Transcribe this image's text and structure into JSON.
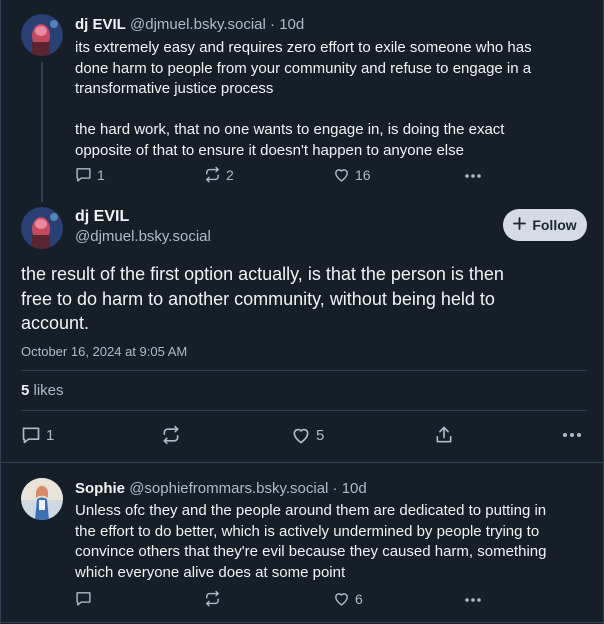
{
  "reply_parent": {
    "author_name": "dj EVIL",
    "author_handle": "@djmuel.bsky.social",
    "time_sep": "·",
    "age": "10d",
    "text_lines": [
      "its extremely easy and requires zero effort to exile someone who has",
      "done harm to people from your community and refuse to engage in a",
      "transformative justice process",
      "",
      "the hard work, that no one wants to engage in, is doing the exact",
      "opposite of that to ensure it doesn't happen to anyone else"
    ],
    "reply_count": "1",
    "repost_count": "2",
    "like_count": "16"
  },
  "main_post": {
    "author_name": "dj EVIL",
    "author_handle": "@djmuel.bsky.social",
    "follow_label": "Follow",
    "text_lines": [
      "the result of the first option actually, is that the person is then",
      "free to do harm to another community, without being held to",
      "account."
    ],
    "timestamp": "October 16, 2024 at 9:05 AM",
    "likes_count": "5",
    "likes_label": "likes",
    "reply_count": "1",
    "like_count": "5"
  },
  "reply": {
    "author_name": "Sophie",
    "author_handle": "@sophiefrommars.bsky.social",
    "time_sep": "·",
    "age": "10d",
    "text_lines": [
      "Unless ofc they and the people around them are dedicated to putting in",
      "the effort to do better, which is actively undermined by people trying to",
      "convince others that they're evil because they caused harm, something",
      "which everyone alive does at some point"
    ],
    "like_count": "6"
  },
  "colors": {
    "background": "#161e27",
    "border": "#2e4052",
    "muted_text": "#aebbc9",
    "primary_text": "#f1f3f5",
    "follow_button_bg": "#d4dbe2"
  },
  "icons": [
    "reply-icon",
    "repost-icon",
    "like-icon",
    "more-icon",
    "share-icon",
    "plus-icon"
  ]
}
